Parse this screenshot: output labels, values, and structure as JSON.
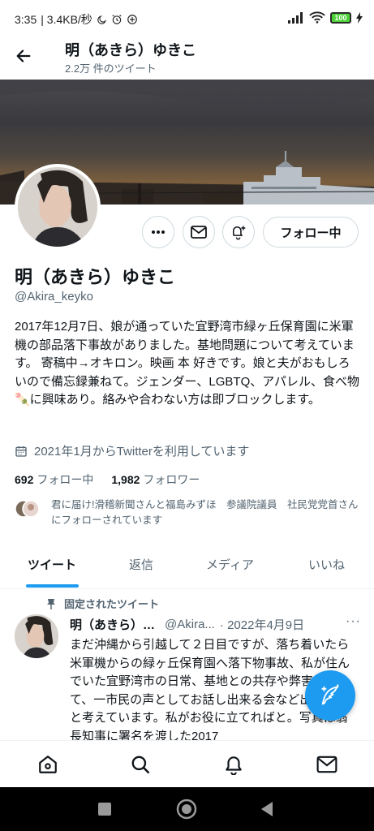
{
  "status_bar": {
    "time": "3:35",
    "network_speed": "| 3.4KB/秒",
    "battery": "100"
  },
  "header": {
    "title": "明（あきら）ゆきこ",
    "tweet_count": "2.2万 件のツイート"
  },
  "profile": {
    "name": "明（あきら）ゆきこ",
    "handle": "@Akira_keyko",
    "bio": "2017年12月7日、娘が通っていた宜野湾市緑ヶ丘保育園に米軍機の部品落下事故がありました。基地問題について考えています。 寄稿中→オキロン。映画 本 好きです。娘と夫がおもしろいので備忘録兼ねて。ジェンダー、LGBTQ、アパレル、食べ物🍡に興味あり。絡みや合わない方は即ブロックします。",
    "joined": "2021年1月からTwitterを利用しています",
    "following_count": "692",
    "following_label": "フォロー中",
    "followers_count": "1,982",
    "followers_label": "フォロワー",
    "followed_by": "君に届け!滑稽新聞さんと福島みずほ　参議院議員　社民党党首さんにフォローされています",
    "follow_button": "フォロー中"
  },
  "tabs": [
    {
      "label": "ツイート",
      "active": true
    },
    {
      "label": "返信",
      "active": false
    },
    {
      "label": "メディア",
      "active": false
    },
    {
      "label": "いいね",
      "active": false
    }
  ],
  "pinned_tweet": {
    "pinned_label": "固定されたツイート",
    "author_name": "明（あきら）…",
    "author_handle": "@Akira...",
    "date": "· 2022年4月9日",
    "more": "···",
    "text": "まだ沖縄から引越して２日目ですが、落ち着いたら米軍機からの緑ヶ丘保育園へ落下物事故、私が住んでいた宜野湾市の日常、基地との共存や弊害について、一市民の声としてお話し出来る会など出来たらと考えています。私がお役に立てればと。写真は翁長知事に署名を渡した2017"
  },
  "icons": {
    "back": "arrow-left-icon",
    "more": "more-horizontal-icon",
    "message": "envelope-icon",
    "notify": "bell-plus-icon",
    "calendar": "calendar-icon",
    "pin": "pin-icon",
    "compose": "compose-feather-icon",
    "nav_home": "home-icon",
    "nav_search": "search-icon",
    "nav_notifications": "bell-icon",
    "nav_messages": "envelope-icon"
  },
  "colors": {
    "accent": "#1d9bf0",
    "text_primary": "#0f1419",
    "text_secondary": "#536471",
    "battery": "#4cd137"
  }
}
